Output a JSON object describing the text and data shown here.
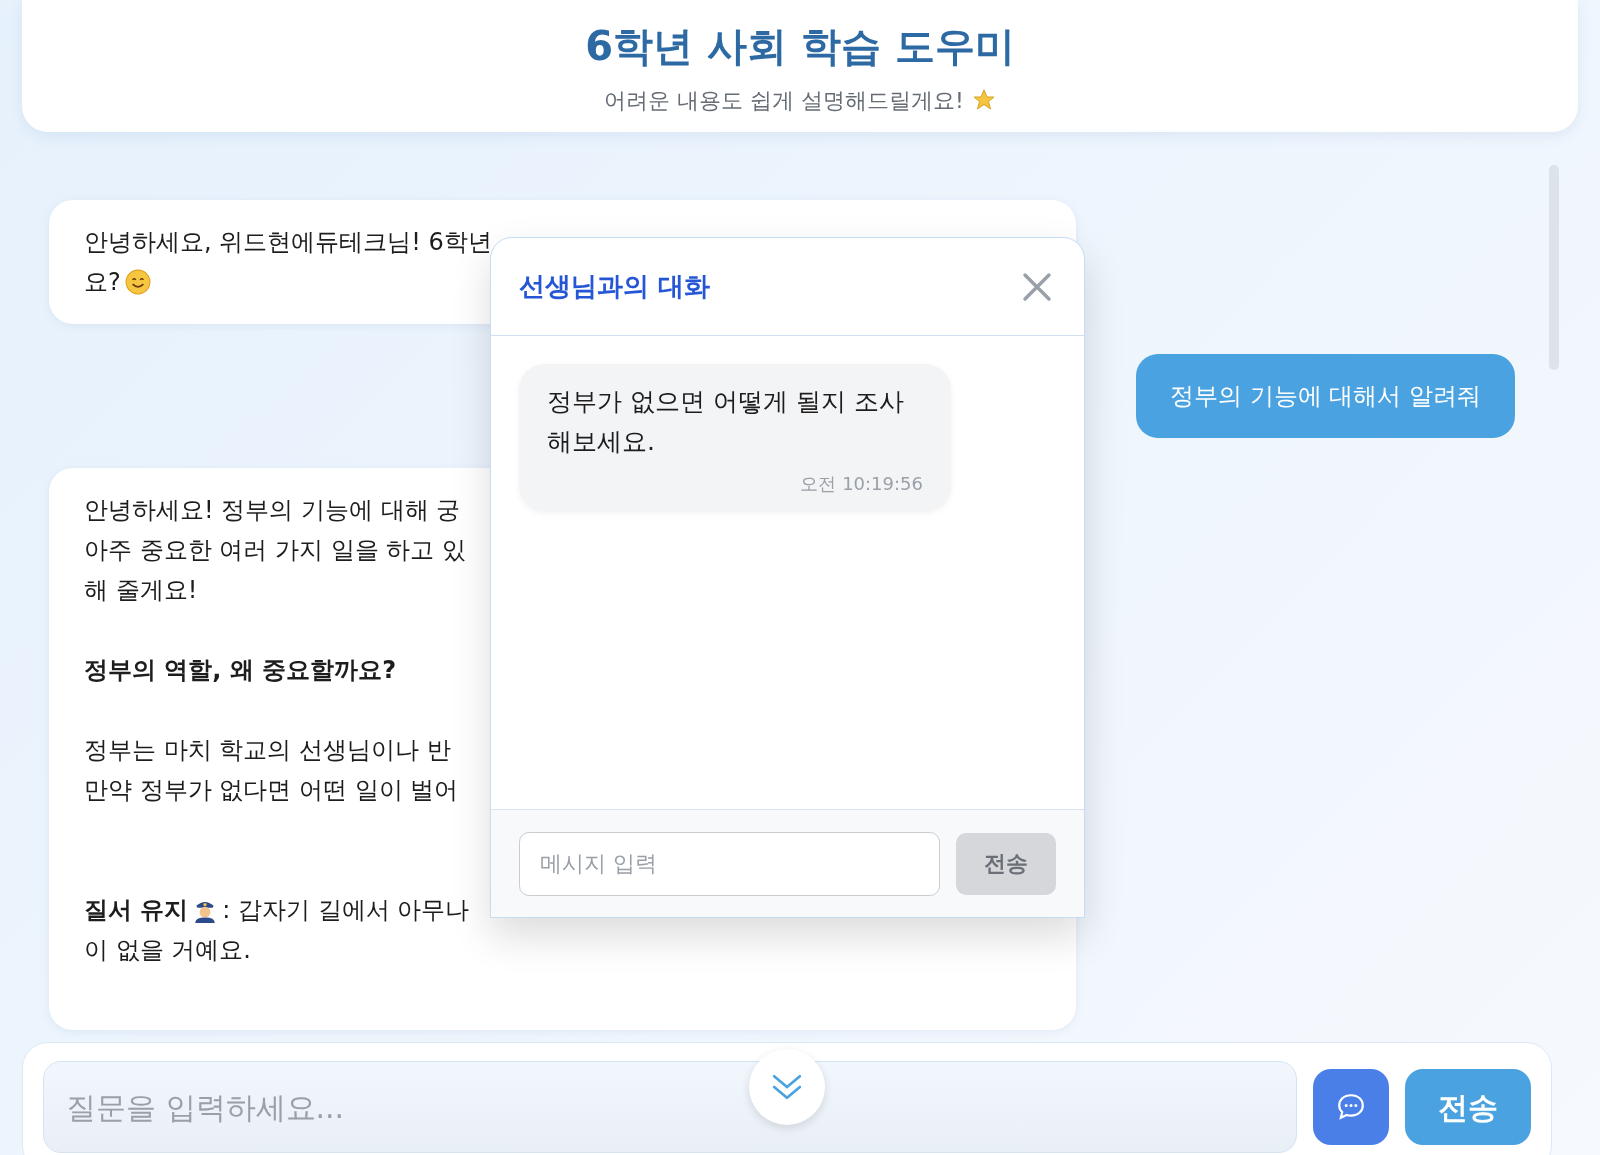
{
  "header": {
    "title": "6학년 사회 학습 도우미",
    "subtitle": "어려운 내용도 쉽게 설명해드릴게요!"
  },
  "messages": [
    {
      "kind": "bot",
      "lines": [
        {
          "kind": "text",
          "text": "안녕하세요, 위드현에듀테크님! 6학년"
        },
        {
          "kind": "closing",
          "text": "요?"
        }
      ]
    },
    {
      "kind": "user",
      "text": "정부의 기능에 대해서 알려줘"
    },
    {
      "kind": "bot",
      "lines": [
        {
          "kind": "text",
          "text": "안녕하세요! 정부의 기능에 대해 궁"
        },
        {
          "kind": "text",
          "text": "아주 중요한 여러 가지 일을 하고 있"
        },
        {
          "kind": "text",
          "text": "해 줄게요!"
        },
        {
          "kind": "gap"
        },
        {
          "kind": "heading",
          "text": "정부의 역할, 왜 중요할까요?"
        },
        {
          "kind": "gap"
        },
        {
          "kind": "text",
          "text": "정부는 마치 학교의 선생님이나 반"
        },
        {
          "kind": "text",
          "text": "만약 정부가 없다면 어떤 일이 벌어"
        },
        {
          "kind": "gap"
        },
        {
          "kind": "gap"
        },
        {
          "kind": "item",
          "label": "질서 유지",
          "text": ": 갑자기 길에서 아무나"
        },
        {
          "kind": "text",
          "text": "이 없을 거예요."
        }
      ]
    }
  ],
  "dialog": {
    "title": "선생님과의 대화",
    "messages": [
      {
        "text": "정부가 없으면 어떻게 될지 조사해보세요.",
        "time": "오전 10:19:56"
      }
    ],
    "input": {
      "placeholder": "메시지 입력"
    },
    "send": {
      "label": "전송",
      "disabled": true
    }
  },
  "composer": {
    "placeholder": "질문을 입력하세요...",
    "send": "전송"
  }
}
